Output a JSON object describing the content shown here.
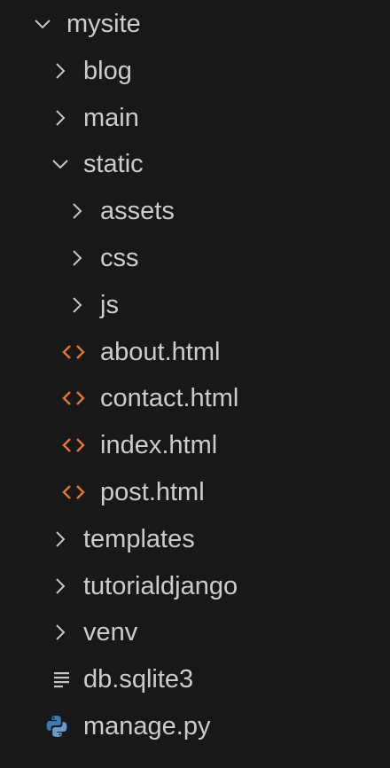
{
  "explorer": {
    "items": [
      {
        "label": "mysite",
        "icon": "chevron-down-icon"
      },
      {
        "label": "blog",
        "icon": "chevron-right-icon"
      },
      {
        "label": "main",
        "icon": "chevron-right-icon"
      },
      {
        "label": "static",
        "icon": "chevron-down-icon"
      },
      {
        "label": "assets",
        "icon": "chevron-right-icon"
      },
      {
        "label": "css",
        "icon": "chevron-right-icon"
      },
      {
        "label": "js",
        "icon": "chevron-right-icon"
      },
      {
        "label": "about.html",
        "icon": "html-file-icon"
      },
      {
        "label": "contact.html",
        "icon": "html-file-icon"
      },
      {
        "label": "index.html",
        "icon": "html-file-icon"
      },
      {
        "label": "post.html",
        "icon": "html-file-icon"
      },
      {
        "label": "templates",
        "icon": "chevron-right-icon"
      },
      {
        "label": "tutorialdjango",
        "icon": "chevron-right-icon"
      },
      {
        "label": "venv",
        "icon": "chevron-right-icon"
      },
      {
        "label": "db.sqlite3",
        "icon": "text-file-icon"
      },
      {
        "label": "manage.py",
        "icon": "python-file-icon"
      }
    ]
  },
  "colors": {
    "background": "#181818",
    "text": "#cccccc",
    "chevron": "#c5c5c5",
    "html_icon": "#e37933",
    "python_blue": "#3d7ab3",
    "python_light": "#6b9ccb"
  }
}
